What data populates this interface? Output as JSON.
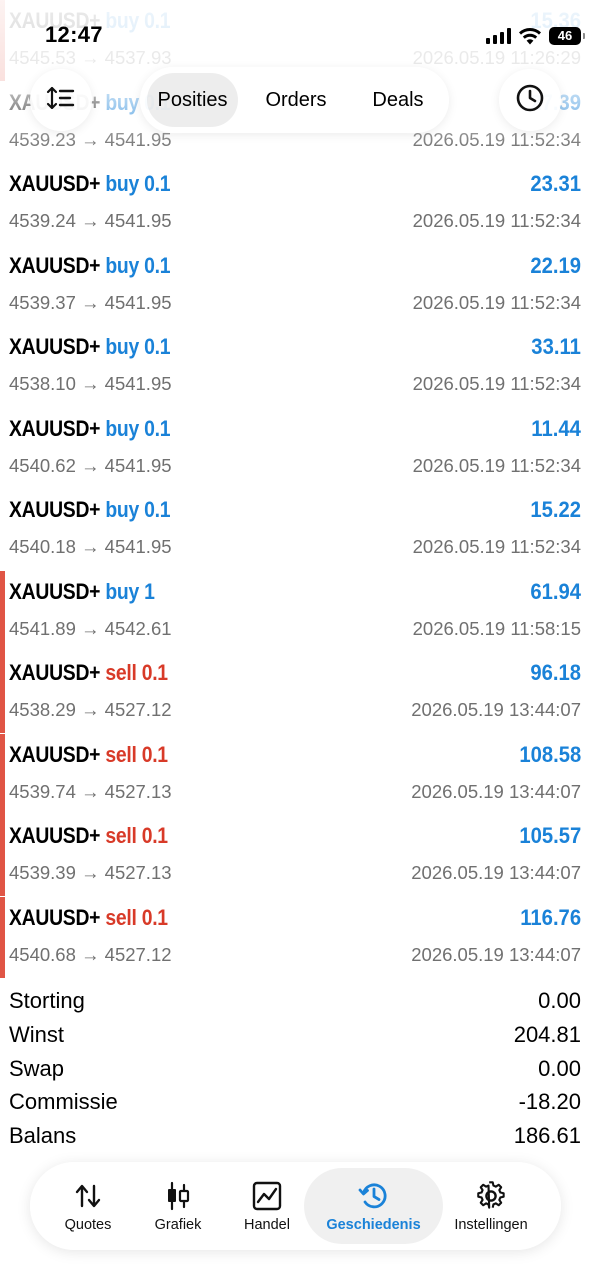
{
  "status_bar": {
    "time": "12:47",
    "battery": "46"
  },
  "toolbar": {
    "tabs": [
      {
        "label": "Posities",
        "active": true
      },
      {
        "label": "Orders",
        "active": false
      },
      {
        "label": "Deals",
        "active": false
      }
    ]
  },
  "deals": [
    {
      "symbol": "XAUUSD+",
      "side": "buy",
      "volume": "0.1",
      "open_price": "4545.53",
      "close_price": "4537.93",
      "profit": "15.36",
      "time": "2026.05.19 11:26:29",
      "marked": true
    },
    {
      "symbol": "XAUUSD+",
      "side": "buy",
      "volume": "0.1",
      "open_price": "4539.23",
      "close_price": "4541.95",
      "profit": "27.39",
      "time": "2026.05.19 11:52:34",
      "marked": false
    },
    {
      "symbol": "XAUUSD+",
      "side": "buy",
      "volume": "0.1",
      "open_price": "4539.24",
      "close_price": "4541.95",
      "profit": "23.31",
      "time": "2026.05.19 11:52:34",
      "marked": false
    },
    {
      "symbol": "XAUUSD+",
      "side": "buy",
      "volume": "0.1",
      "open_price": "4539.37",
      "close_price": "4541.95",
      "profit": "22.19",
      "time": "2026.05.19 11:52:34",
      "marked": false
    },
    {
      "symbol": "XAUUSD+",
      "side": "buy",
      "volume": "0.1",
      "open_price": "4538.10",
      "close_price": "4541.95",
      "profit": "33.11",
      "time": "2026.05.19 11:52:34",
      "marked": false
    },
    {
      "symbol": "XAUUSD+",
      "side": "buy",
      "volume": "0.1",
      "open_price": "4540.62",
      "close_price": "4541.95",
      "profit": "11.44",
      "time": "2026.05.19 11:52:34",
      "marked": false
    },
    {
      "symbol": "XAUUSD+",
      "side": "buy",
      "volume": "0.1",
      "open_price": "4540.18",
      "close_price": "4541.95",
      "profit": "15.22",
      "time": "2026.05.19 11:52:34",
      "marked": false
    },
    {
      "symbol": "XAUUSD+",
      "side": "buy",
      "volume": "1",
      "open_price": "4541.89",
      "close_price": "4542.61",
      "profit": "61.94",
      "time": "2026.05.19 11:58:15",
      "marked": true
    },
    {
      "symbol": "XAUUSD+",
      "side": "sell",
      "volume": "0.1",
      "open_price": "4538.29",
      "close_price": "4527.12",
      "profit": "96.18",
      "time": "2026.05.19 13:44:07",
      "marked": true
    },
    {
      "symbol": "XAUUSD+",
      "side": "sell",
      "volume": "0.1",
      "open_price": "4539.74",
      "close_price": "4527.13",
      "profit": "108.58",
      "time": "2026.05.19 13:44:07",
      "marked": true
    },
    {
      "symbol": "XAUUSD+",
      "side": "sell",
      "volume": "0.1",
      "open_price": "4539.39",
      "close_price": "4527.13",
      "profit": "105.57",
      "time": "2026.05.19 13:44:07",
      "marked": true
    },
    {
      "symbol": "XAUUSD+",
      "side": "sell",
      "volume": "0.1",
      "open_price": "4540.68",
      "close_price": "4527.12",
      "profit": "116.76",
      "time": "2026.05.19 13:44:07",
      "marked": true
    }
  ],
  "summary": [
    {
      "label": "Storting",
      "value": "0.00"
    },
    {
      "label": "Winst",
      "value": "204.81"
    },
    {
      "label": "Swap",
      "value": "0.00"
    },
    {
      "label": "Commissie",
      "value": "-18.20"
    },
    {
      "label": "Balans",
      "value": "186.61"
    }
  ],
  "bottom_nav": [
    {
      "label": "Quotes",
      "icon": "up-down-arrows-icon",
      "active": false
    },
    {
      "label": "Grafiek",
      "icon": "candlestick-icon",
      "active": false
    },
    {
      "label": "Handel",
      "icon": "line-chart-icon",
      "active": false
    },
    {
      "label": "Geschiedenis",
      "icon": "history-clock-icon",
      "active": true
    },
    {
      "label": "Instellingen",
      "icon": "gear-icon",
      "active": false
    }
  ],
  "colors": {
    "buy": "#1a82d8",
    "sell": "#d83a28",
    "profit": "#1a82d8",
    "marker": "#e05545",
    "secondary_text": "#707070"
  }
}
